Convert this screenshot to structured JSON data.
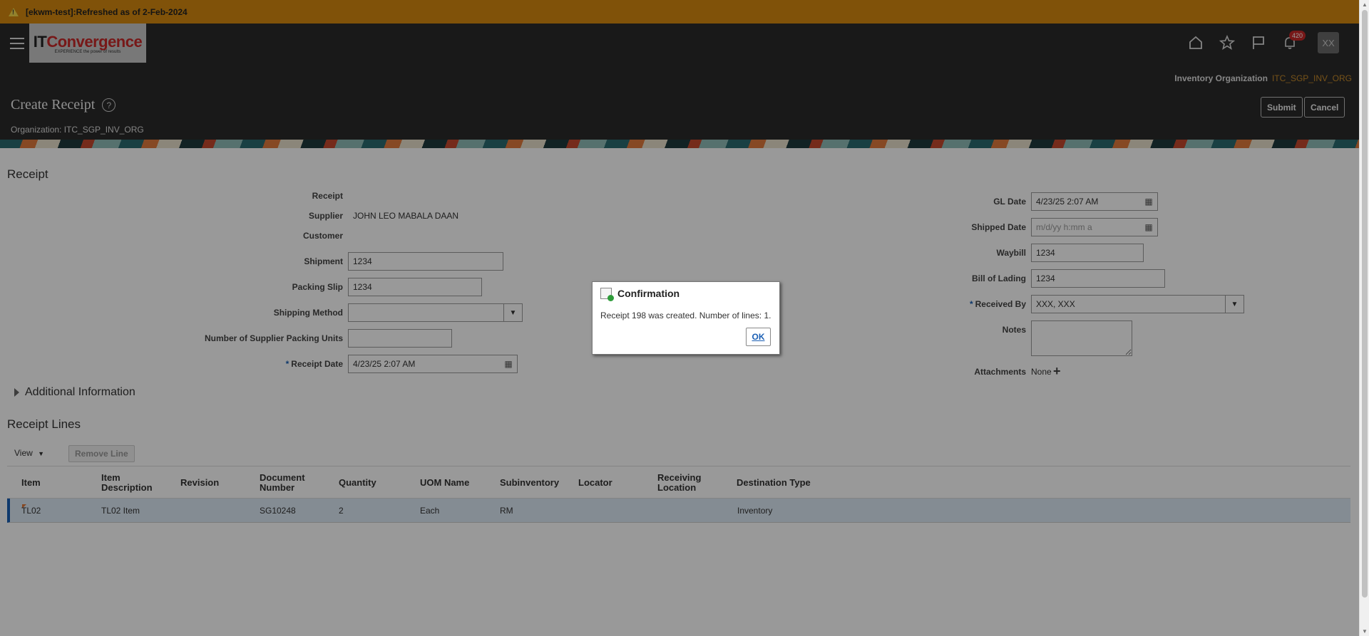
{
  "banner": {
    "text": "[ekwm-test]:Refreshed as of 2-Feb-2024"
  },
  "header": {
    "logo_brand_a": "IT",
    "logo_brand_b": "Convergence",
    "logo_tagline": "EXPERIENCE the power of results",
    "notification_count": "420",
    "avatar_initials": "XX",
    "inv_org_label": "Inventory Organization",
    "inv_org_value": "ITC_SGP_INV_ORG",
    "page_title": "Create Receipt",
    "organization_line": "Organization: ITC_SGP_INV_ORG",
    "submit_label": "Submit",
    "cancel_label": "Cancel"
  },
  "receipt": {
    "section_title": "Receipt",
    "left": {
      "receipt_label": "Receipt",
      "supplier_label": "Supplier",
      "supplier_value": "JOHN LEO MABALA DAAN",
      "customer_label": "Customer",
      "shipment_label": "Shipment",
      "shipment_value": "1234",
      "packing_slip_label": "Packing Slip",
      "packing_slip_value": "1234",
      "shipping_method_label": "Shipping Method",
      "shipping_method_value": "",
      "num_packing_units_label": "Number of Supplier Packing Units",
      "num_packing_units_value": "",
      "receipt_date_label": "Receipt Date",
      "receipt_date_value": "4/23/25 2:07 AM"
    },
    "right": {
      "gl_date_label": "GL Date",
      "gl_date_value": "4/23/25 2:07 AM",
      "shipped_date_label": "Shipped Date",
      "shipped_date_placeholder": "m/d/yy h:mm a",
      "waybill_label": "Waybill",
      "waybill_value": "1234",
      "bill_of_lading_label": "Bill of Lading",
      "bill_of_lading_value": "1234",
      "received_by_label": "Received By",
      "received_by_value": "XXX, XXX",
      "notes_label": "Notes",
      "attachments_label": "Attachments",
      "attachments_value": "None"
    },
    "additional_info_label": "Additional Information"
  },
  "lines": {
    "section_title": "Receipt Lines",
    "view_label": "View",
    "remove_label": "Remove Line",
    "columns": {
      "item": "Item",
      "item_desc_1": "Item",
      "item_desc_2": "Description",
      "revision": "Revision",
      "doc_num_1": "Document",
      "doc_num_2": "Number",
      "quantity": "Quantity",
      "uom": "UOM Name",
      "subinventory": "Subinventory",
      "locator": "Locator",
      "recv_loc_1": "Receiving",
      "recv_loc_2": "Location",
      "dest_type": "Destination Type"
    },
    "rows": [
      {
        "item": "TL02",
        "item_description": "TL02 Item",
        "revision": "",
        "document_number": "SG10248",
        "quantity": "2",
        "uom": "Each",
        "subinventory": "RM",
        "locator": "",
        "receiving_location": "",
        "destination_type": "Inventory"
      }
    ]
  },
  "dialog": {
    "title": "Confirmation",
    "message": "Receipt 198 was created. Number of lines: 1.",
    "ok_label": "OK"
  }
}
